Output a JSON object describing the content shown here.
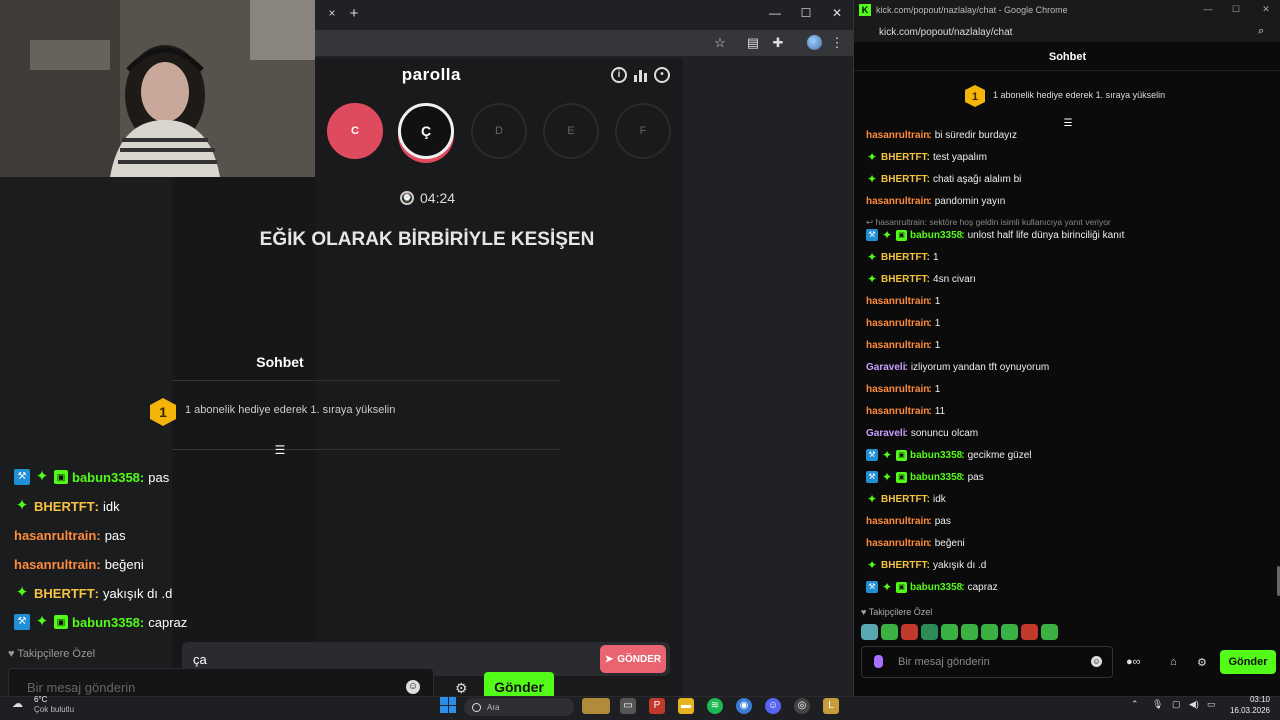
{
  "left_window": {
    "tab_close": "×",
    "tab_new": "+",
    "window_controls": [
      "—",
      "☐",
      "✕"
    ]
  },
  "parolla": {
    "title": "parolla",
    "letters": [
      "C",
      "Ç",
      "D",
      "E",
      "F"
    ],
    "timer": "04:24",
    "question": "EĞİK OLARAK BİRBİRİYLE KESİŞEN"
  },
  "overlay_chat": {
    "header": "Sohbet",
    "sub_notice": "1 abonelik hediye ederek 1. sıraya yükselin",
    "rank_number": "1",
    "input_value": "ça",
    "send_label": "GÖNDER"
  },
  "stream_chat": {
    "messages": [
      {
        "user": "babun3358",
        "text": "pas",
        "color": "#53fc18",
        "badges": [
          "mod",
          "star",
          "gift"
        ]
      },
      {
        "user": "BHERTFT",
        "text": "idk",
        "color": "#f5c242",
        "badges": [
          "star"
        ]
      },
      {
        "user": "hasanrultrain",
        "text": "pas",
        "color": "#ff8b3d",
        "badges": []
      },
      {
        "user": "hasanrultrain",
        "text": "beğeni",
        "color": "#ff8b3d",
        "badges": []
      },
      {
        "user": "BHERTFT",
        "text": "yakışık dı .d",
        "color": "#f5c242",
        "badges": [
          "star"
        ]
      },
      {
        "user": "babun3358",
        "text": "capraz",
        "color": "#53fc18",
        "badges": [
          "mod",
          "star",
          "gift"
        ]
      }
    ],
    "followers_only": "Takipçilere Özel",
    "input_placeholder": "Bir mesaj gönderin",
    "send_label": "Gönder"
  },
  "kick_window": {
    "title": "kick.com/popout/nazlalay/chat - Google Chrome",
    "address": "kick.com/popout/nazlalay/chat",
    "header": "Sohbet",
    "sub_notice": "1 abonelik hediye ederek 1. sıraya yükselin",
    "rank_number": "1",
    "reply_context": "hasanrultrain: sektöre hoş geldin isimli kullanıcıya yanıt veriyor",
    "messages": [
      {
        "user": "hasanrultrain",
        "text": "bi süredir burdayız",
        "color": "#ff8b3d",
        "badges": []
      },
      {
        "user": "BHERTFT",
        "text": "test yapalım",
        "color": "#f5c242",
        "badges": [
          "star"
        ]
      },
      {
        "user": "BHERTFT",
        "text": "chati aşağı alalım bi",
        "color": "#f5c242",
        "badges": [
          "star"
        ]
      },
      {
        "user": "hasanrultrain",
        "text": "pandomin yayın",
        "color": "#ff8b3d",
        "badges": []
      },
      {
        "user": "babun3358",
        "text": "unlost half life dünya birinciliği kanıt",
        "color": "#53fc18",
        "badges": [
          "mod",
          "star",
          "gift"
        ]
      },
      {
        "user": "BHERTFT",
        "text": "1",
        "color": "#f5c242",
        "badges": [
          "star"
        ]
      },
      {
        "user": "BHERTFT",
        "text": "4sn civarı",
        "color": "#f5c242",
        "badges": [
          "star"
        ]
      },
      {
        "user": "hasanrultrain",
        "text": "1",
        "color": "#ff8b3d",
        "badges": []
      },
      {
        "user": "hasanrultrain",
        "text": "1",
        "color": "#ff8b3d",
        "badges": []
      },
      {
        "user": "hasanrultrain",
        "text": "1",
        "color": "#ff8b3d",
        "badges": []
      },
      {
        "user": "Garaveli",
        "text": "izliyorum yandan tft oynuyorum",
        "color": "#c9a0ff",
        "badges": []
      },
      {
        "user": "hasanrultrain",
        "text": "1",
        "color": "#ff8b3d",
        "badges": []
      },
      {
        "user": "hasanrultrain",
        "text": "11",
        "color": "#ff8b3d",
        "badges": []
      },
      {
        "user": "Garaveli",
        "text": "sonuncu olcam",
        "color": "#c9a0ff",
        "badges": []
      },
      {
        "user": "babun3358",
        "text": "gecikme güzel",
        "color": "#53fc18",
        "badges": [
          "mod",
          "star",
          "gift"
        ]
      },
      {
        "user": "babun3358",
        "text": "pas",
        "color": "#53fc18",
        "badges": [
          "mod",
          "star",
          "gift"
        ]
      },
      {
        "user": "BHERTFT",
        "text": "idk",
        "color": "#f5c242",
        "badges": [
          "star"
        ]
      },
      {
        "user": "hasanrultrain",
        "text": "pas",
        "color": "#ff8b3d",
        "badges": []
      },
      {
        "user": "hasanrultrain",
        "text": "beğeni",
        "color": "#ff8b3d",
        "badges": []
      },
      {
        "user": "BHERTFT",
        "text": "yakışık dı .d",
        "color": "#f5c242",
        "badges": [
          "star"
        ]
      },
      {
        "user": "babun3358",
        "text": "capraz",
        "color": "#53fc18",
        "badges": [
          "mod",
          "star",
          "gift"
        ]
      }
    ],
    "followers_only": "Takipçilere Özel",
    "input_placeholder": "Bir mesaj gönderin",
    "send_label": "Gönder"
  },
  "taskbar": {
    "weather_temp": "6°C",
    "weather_desc": "Çok bulutlu",
    "search_placeholder": "Ara",
    "time": "03:10",
    "date": "16.03.2026"
  },
  "colors": {
    "kick_green": "#53fc18",
    "parolla_red": "#e04a5f",
    "send_pink": "#e96370"
  }
}
